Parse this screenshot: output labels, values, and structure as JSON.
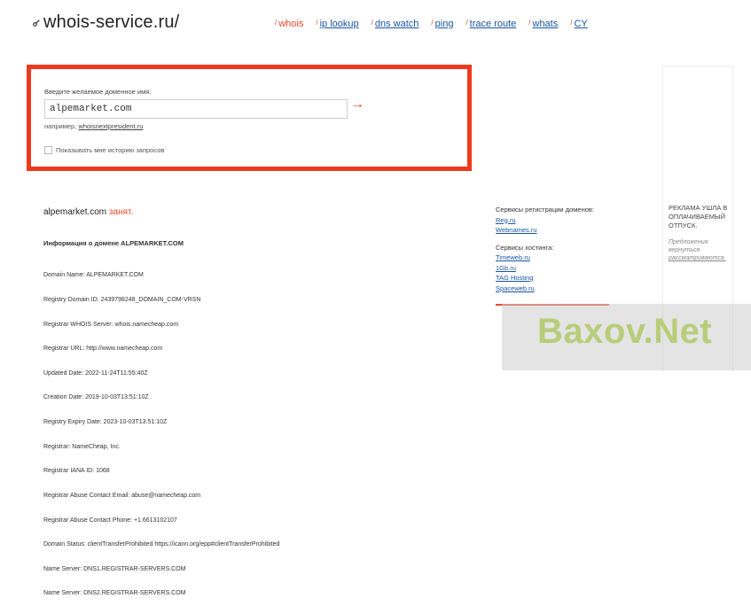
{
  "header": {
    "logo": "whois-service.ru/",
    "nav": [
      {
        "label": "whois",
        "active": true
      },
      {
        "label": "ip lookup",
        "active": false
      },
      {
        "label": "dns watch",
        "active": false
      },
      {
        "label": "ping",
        "active": false
      },
      {
        "label": "trace route",
        "active": false
      },
      {
        "label": "whats",
        "active": false
      },
      {
        "label": "CY",
        "active": false
      }
    ]
  },
  "search": {
    "label": "Введите желаемое доменное имя:",
    "value": "alpemarket.com",
    "arrow": "→",
    "example_prefix": "например,",
    "example_link": "whoisnextpresident.ru",
    "history_label": "Показывать мне историю запросов",
    "history_checked": false
  },
  "result": {
    "domain": "alpemarket.com",
    "status": "занят.",
    "info_title": "Информация о домене ALPEMARKET.COM",
    "lines": [
      "Domain Name: ALPEMARKET.COM",
      "Registry Domain ID: 2439798248_DOMAIN_COM-VRSN",
      "Registrar WHOIS Server: whois.namecheap.com",
      "Registrar URL: http://www.namecheap.com",
      "Updated Date: 2022-11-24T11:55:40Z",
      "Creation Date: 2019-10-03T13:51:10Z",
      "Registry Expiry Date: 2023-10-03T13:51:10Z",
      "Registrar: NameCheap, Inc.",
      "Registrar IANA ID: 1068",
      "Registrar Abuse Contact Email: abuse@namecheap.com",
      "Registrar Abuse Contact Phone: +1.6613102107",
      "Domain Status: clientTransferProhibited https://icann.org/epp#clientTransferProhibited",
      "Name Server: DNS1.REGISTRAR-SERVERS.COM",
      "Name Server: DNS2.REGISTRAR-SERVERS.COM"
    ]
  },
  "services": {
    "registration_heading": "Сервисы регистрации доменов:",
    "registration_links": [
      "Reg.ru",
      "Webnames.ru"
    ],
    "hosting_heading": "Сервисы хостинга:",
    "hosting_links": [
      "Timeweb.ru",
      "1Gb.ru",
      "TAG Hosting",
      "Spaceweb.ru"
    ]
  },
  "ad": {
    "title": "РЕКЛАМА УШЛА В ОПЛАЧИВАЕМЫЙ ОТПУСК.",
    "note_prefix": "Предложения вернуться",
    "note_link": "рассматриваются."
  },
  "watermark": "Baxov.Net",
  "colors": {
    "accent": "#e8472a",
    "box_border": "#ee3a1c",
    "link": "#1a55a0"
  }
}
